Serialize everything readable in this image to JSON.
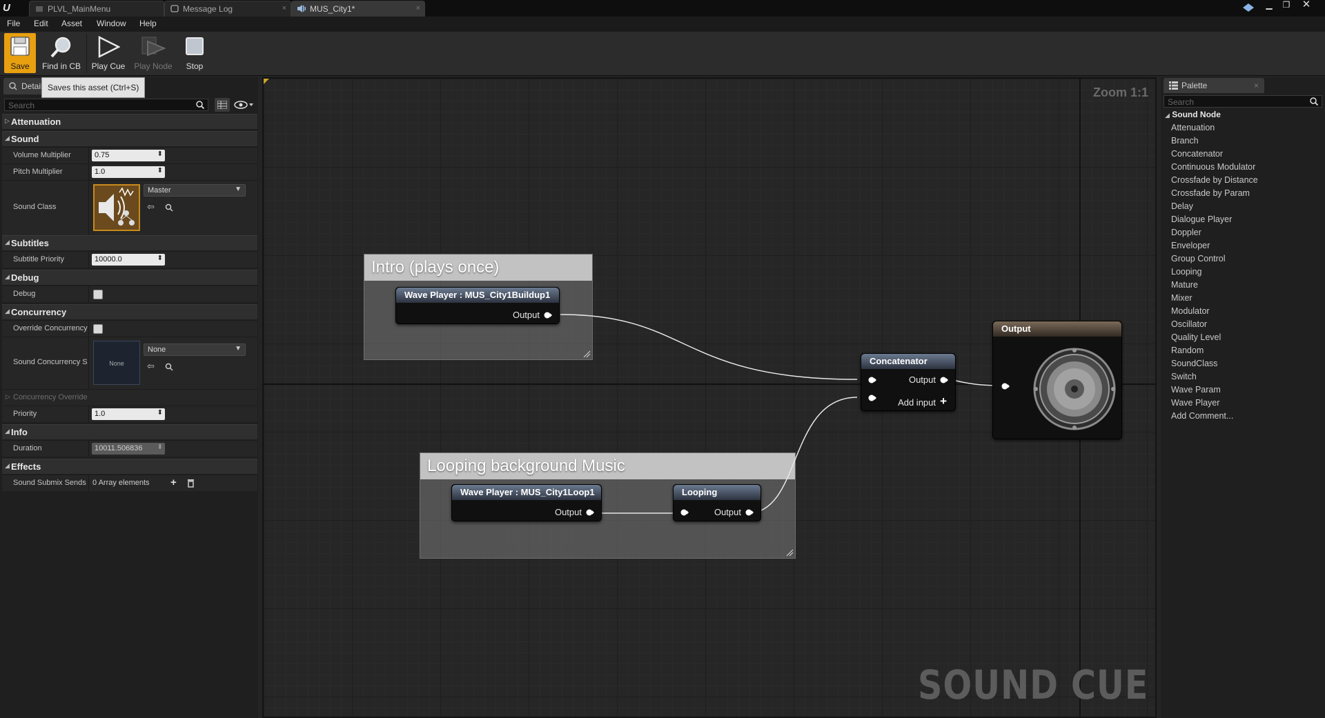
{
  "window": {
    "tabs": [
      {
        "label": "PLVL_MainMenu"
      },
      {
        "label": "Message Log"
      },
      {
        "label": "MUS_City1*"
      }
    ]
  },
  "menu": [
    "File",
    "Edit",
    "Asset",
    "Window",
    "Help"
  ],
  "toolbar": {
    "save": "Save",
    "find_in_cb": "Find in CB",
    "play_cue": "Play Cue",
    "play_node": "Play Node",
    "stop": "Stop",
    "save_tooltip": "Saves this asset (Ctrl+S)"
  },
  "details": {
    "tab_label": "Details",
    "search_placeholder": "Search",
    "categories": {
      "attenuation": "Attenuation",
      "sound": "Sound",
      "subtitles": "Subtitles",
      "debug": "Debug",
      "concurrency": "Concurrency",
      "info": "Info",
      "effects": "Effects"
    },
    "props": {
      "volume_multiplier_label": "Volume Multiplier",
      "volume_multiplier_value": "0.75",
      "pitch_multiplier_label": "Pitch Multiplier",
      "pitch_multiplier_value": "1.0",
      "sound_class_label": "Sound Class",
      "sound_class_value": "Master",
      "subtitle_priority_label": "Subtitle Priority",
      "subtitle_priority_value": "10000.0",
      "debug_label": "Debug",
      "override_concurrency_label": "Override Concurrency",
      "sound_concurrency_label": "Sound Concurrency S",
      "sound_concurrency_thumb": "None",
      "sound_concurrency_value": "None",
      "concurrency_overrides_label": "Concurrency Override",
      "priority_label": "Priority",
      "priority_value": "1.0",
      "duration_label": "Duration",
      "duration_value": "10011.506836",
      "submix_sends_label": "Sound Submix Sends",
      "submix_sends_value": "0 Array elements"
    }
  },
  "graph": {
    "zoom": "Zoom 1:1",
    "watermark": "SOUND CUE",
    "comments": {
      "intro": "Intro (plays once)",
      "looping": "Looping background Music"
    },
    "nodes": {
      "wave_intro": "Wave Player : MUS_City1Buildup1",
      "wave_loop": "Wave Player : MUS_City1Loop1",
      "looping": "Looping",
      "concatenator": "Concatenator",
      "output": "Output"
    },
    "pins": {
      "output": "Output",
      "add_input": "Add input"
    }
  },
  "palette": {
    "tab_label": "Palette",
    "search_placeholder": "Search",
    "root": "Sound Node",
    "items": [
      "Attenuation",
      "Branch",
      "Concatenator",
      "Continuous Modulator",
      "Crossfade by Distance",
      "Crossfade by Param",
      "Delay",
      "Dialogue Player",
      "Doppler",
      "Enveloper",
      "Group Control",
      "Looping",
      "Mature",
      "Mixer",
      "Modulator",
      "Oscillator",
      "Quality Level",
      "Random",
      "SoundClass",
      "Switch",
      "Wave Param",
      "Wave Player",
      "Add Comment..."
    ]
  }
}
